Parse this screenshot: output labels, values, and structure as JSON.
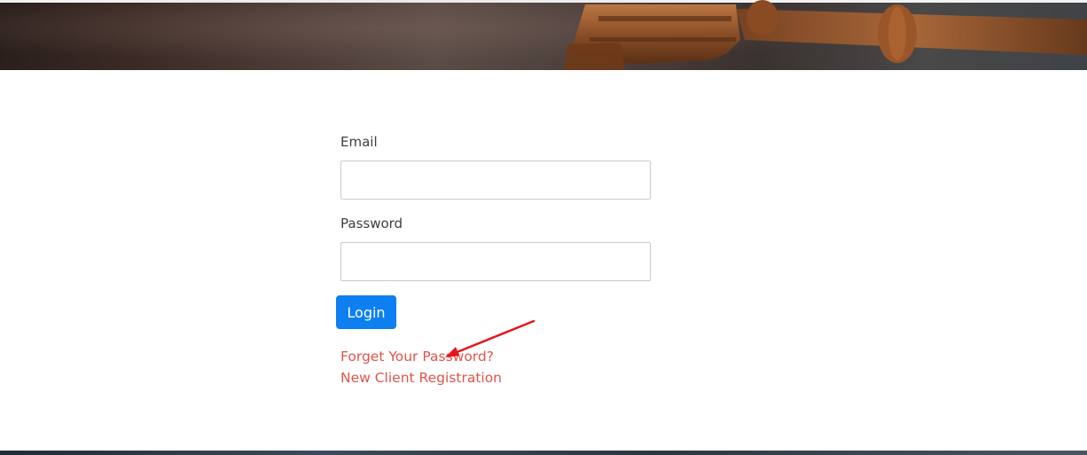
{
  "form": {
    "email_label": "Email",
    "email_value": "",
    "password_label": "Password",
    "password_value": "",
    "login_label": "Login"
  },
  "links": {
    "forgot_password": "Forget Your Password?",
    "new_client_registration": "New Client Registration"
  },
  "colors": {
    "primary_button": "#0d7ff0",
    "link": "#e0544a",
    "annotation_arrow": "#e8141b"
  },
  "icons": {
    "annotation": "red-arrow-icon"
  }
}
